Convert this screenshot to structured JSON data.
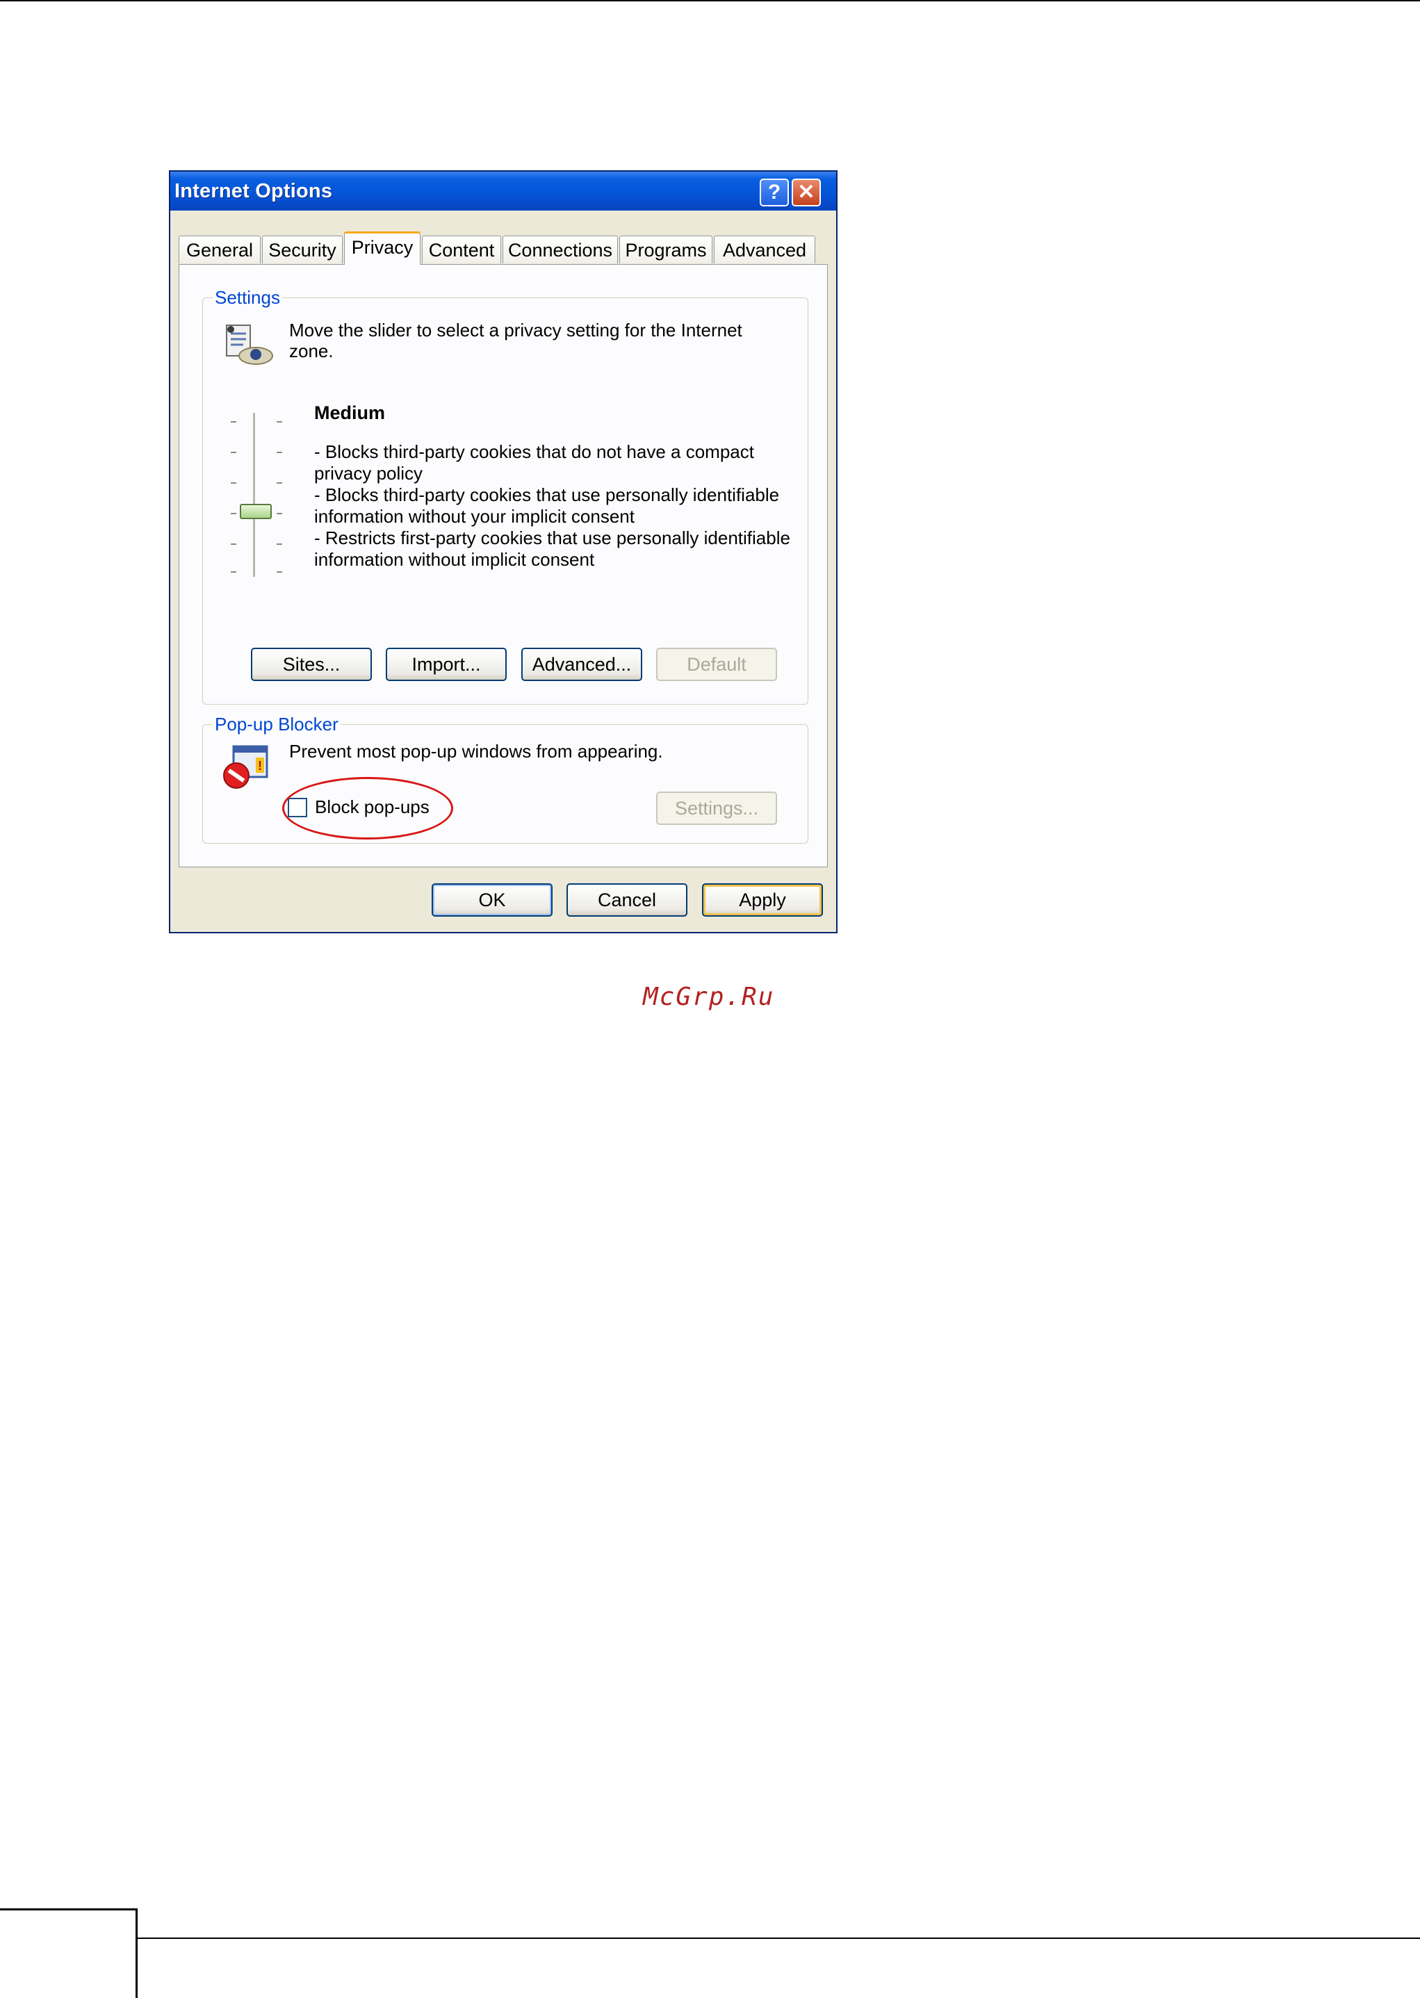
{
  "window": {
    "title": "Internet Options",
    "help_glyph": "?",
    "close_glyph": "✕"
  },
  "tabs": [
    {
      "label": "General"
    },
    {
      "label": "Security"
    },
    {
      "label": "Privacy",
      "active": true
    },
    {
      "label": "Content"
    },
    {
      "label": "Connections"
    },
    {
      "label": "Programs"
    },
    {
      "label": "Advanced"
    }
  ],
  "settings": {
    "group_label": "Settings",
    "description_line1": "Move the slider to select a privacy setting for the Internet",
    "description_line2": "zone.",
    "level_title": "Medium",
    "level_lines": [
      "- Blocks third-party cookies that do not have a compact",
      "privacy policy",
      "- Blocks third-party cookies that use personally identifiable",
      "information without your implicit consent",
      "- Restricts first-party cookies that use personally identifiable",
      "information without implicit consent"
    ],
    "slider_level": "Medium",
    "buttons": {
      "sites": "Sites...",
      "import": "Import...",
      "advanced": "Advanced...",
      "default": "Default"
    }
  },
  "popup_blocker": {
    "group_label": "Pop-up Blocker",
    "description": "Prevent most pop-up windows from appearing.",
    "checkbox_label": "Block pop-ups",
    "checkbox_checked": false,
    "settings_button": "Settings..."
  },
  "footer_buttons": {
    "ok": "OK",
    "cancel": "Cancel",
    "apply": "Apply"
  },
  "watermark": "McGrp.Ru",
  "colors": {
    "titlebar": "#0453d6",
    "dialog_bg": "#ece9d8",
    "group_label": "#0046d5",
    "annotation": "#d81616"
  }
}
